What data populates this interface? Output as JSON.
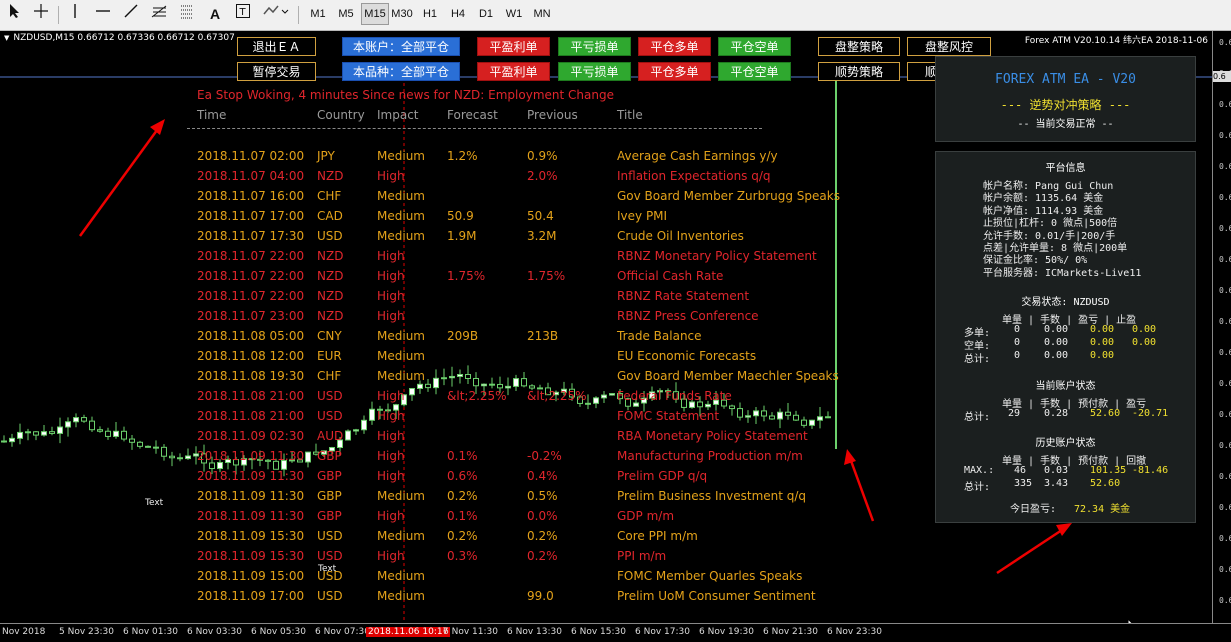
{
  "toolbar": {
    "timeframes": [
      "M1",
      "M5",
      "M15",
      "M30",
      "H1",
      "H4",
      "D1",
      "W1",
      "MN"
    ],
    "active_timeframe": "M15",
    "icons": [
      "cursor-icon",
      "crosshair-icon",
      "vertical-line-icon",
      "horizontal-line-icon",
      "trendline-icon",
      "fibonacci-icon",
      "grid-icon",
      "text-icon",
      "text-label-icon",
      "arrows-icon"
    ]
  },
  "chart": {
    "symbol_line": "NZDUSD,M15  0.66712 0.67336 0.66712 0.67307",
    "top_right": "Forex ATM  V20.10.14  纬六EA 2018-11-06",
    "price_tag": "0.6",
    "price_labels": [
      "0.6",
      "0.6",
      "0.6",
      "0.6",
      "0.6",
      "0.6",
      "0.6",
      "0.6",
      "0.6",
      "0.6",
      "0.6",
      "0.6",
      "0.6",
      "0.6",
      "0.6",
      "0.6",
      "0.6",
      "0.6",
      "0.6"
    ],
    "time_labels": [
      "Nov 2018",
      "5 Nov 23:30",
      "6 Nov 01:30",
      "6 Nov 03:30",
      "6 Nov 05:30",
      "6 Nov 07:30",
      "2018.11.06 10:17",
      "6 Nov 11:30",
      "6 Nov 13:30",
      "6 Nov 15:30",
      "6 Nov 17:30",
      "6 Nov 19:30",
      "6 Nov 21:30",
      "6 Nov 23:30"
    ],
    "text_labels": [
      "Text",
      "Text"
    ]
  },
  "buttons": {
    "row1": [
      "退出ＥＡ",
      "本账户：全部平仓",
      "平盈利单",
      "平亏损单",
      "平仓多单",
      "平仓空单",
      "盘整策略",
      "盘整风控"
    ],
    "row2": [
      "暂停交易",
      "本品种：全部平仓",
      "平盈利单",
      "平亏损单",
      "平仓多单",
      "平仓空单",
      "顺势策略",
      "顺势风控"
    ]
  },
  "news": {
    "title": "Ea Stop Woking, 4 minutes Since news for NZD: Employment Change",
    "headers": {
      "time": "Time",
      "country": "Country",
      "impact": "Impact",
      "forecast": "Forecast",
      "previous": "Previous",
      "title": "Title"
    },
    "rows": [
      {
        "time": "2018.11.07 02:00",
        "country": "JPY",
        "impact": "Medium",
        "forecast": "1.2%",
        "previous": "0.9%",
        "title": "Average Cash Earnings y/y"
      },
      {
        "time": "2018.11.07 04:00",
        "country": "NZD",
        "impact": "High",
        "forecast": "",
        "previous": "2.0%",
        "title": "Inflation Expectations q/q"
      },
      {
        "time": "2018.11.07 16:00",
        "country": "CHF",
        "impact": "Medium",
        "forecast": "",
        "previous": "",
        "title": "Gov Board Member Zurbrugg Speaks"
      },
      {
        "time": "2018.11.07 17:00",
        "country": "CAD",
        "impact": "Medium",
        "forecast": "50.9",
        "previous": "50.4",
        "title": "Ivey PMI"
      },
      {
        "time": "2018.11.07 17:30",
        "country": "USD",
        "impact": "Medium",
        "forecast": "1.9M",
        "previous": "3.2M",
        "title": "Crude Oil Inventories"
      },
      {
        "time": "2018.11.07 22:00",
        "country": "NZD",
        "impact": "High",
        "forecast": "",
        "previous": "",
        "title": "RBNZ Monetary Policy Statement"
      },
      {
        "time": "2018.11.07 22:00",
        "country": "NZD",
        "impact": "High",
        "forecast": "1.75%",
        "previous": "1.75%",
        "title": "Official Cash Rate"
      },
      {
        "time": "2018.11.07 22:00",
        "country": "NZD",
        "impact": "High",
        "forecast": "",
        "previous": "",
        "title": "RBNZ Rate Statement"
      },
      {
        "time": "2018.11.07 23:00",
        "country": "NZD",
        "impact": "High",
        "forecast": "",
        "previous": "",
        "title": "RBNZ Press Conference"
      },
      {
        "time": "2018.11.08 05:00",
        "country": "CNY",
        "impact": "Medium",
        "forecast": "209B",
        "previous": "213B",
        "title": "Trade Balance"
      },
      {
        "time": "2018.11.08 12:00",
        "country": "EUR",
        "impact": "Medium",
        "forecast": "",
        "previous": "",
        "title": "EU Economic Forecasts"
      },
      {
        "time": "2018.11.08 19:30",
        "country": "CHF",
        "impact": "Medium",
        "forecast": "",
        "previous": "",
        "title": "Gov Board Member Maechler Speaks"
      },
      {
        "time": "2018.11.08 21:00",
        "country": "USD",
        "impact": "High",
        "forecast": "&lt;2.25%",
        "previous": "&lt;2.25%",
        "title": "Federal Funds Rate"
      },
      {
        "time": "2018.11.08 21:00",
        "country": "USD",
        "impact": "High",
        "forecast": "",
        "previous": "",
        "title": "FOMC Statement"
      },
      {
        "time": "2018.11.09 02:30",
        "country": "AUD",
        "impact": "High",
        "forecast": "",
        "previous": "",
        "title": "RBA Monetary Policy Statement"
      },
      {
        "time": "2018.11.09 11:30",
        "country": "GBP",
        "impact": "High",
        "forecast": "0.1%",
        "previous": "-0.2%",
        "title": "Manufacturing Production m/m"
      },
      {
        "time": "2018.11.09 11:30",
        "country": "GBP",
        "impact": "High",
        "forecast": "0.6%",
        "previous": "0.4%",
        "title": "Prelim GDP q/q"
      },
      {
        "time": "2018.11.09 11:30",
        "country": "GBP",
        "impact": "Medium",
        "forecast": "0.2%",
        "previous": "0.5%",
        "title": "Prelim Business Investment q/q"
      },
      {
        "time": "2018.11.09 11:30",
        "country": "GBP",
        "impact": "High",
        "forecast": "0.1%",
        "previous": "0.0%",
        "title": "GDP m/m"
      },
      {
        "time": "2018.11.09 15:30",
        "country": "USD",
        "impact": "Medium",
        "forecast": "0.2%",
        "previous": "0.2%",
        "title": "Core PPI m/m"
      },
      {
        "time": "2018.11.09 15:30",
        "country": "USD",
        "impact": "High",
        "forecast": "0.3%",
        "previous": "0.2%",
        "title": "PPI m/m"
      },
      {
        "time": "2018.11.09 15:00",
        "country": "USD",
        "impact": "Medium",
        "forecast": "",
        "previous": "",
        "title": "FOMC Member Quarles Speaks"
      },
      {
        "time": "2018.11.09 17:00",
        "country": "USD",
        "impact": "Medium",
        "forecast": "",
        "previous": "99.0",
        "title": "Prelim UoM Consumer Sentiment"
      }
    ]
  },
  "ea_panel": {
    "title": "FOREX ATM EA - V20",
    "strategy": "--- 逆势对冲策略 ---",
    "status": "-- 当前交易正常 --"
  },
  "info_panel": {
    "platform_title": "平台信息",
    "platform_rows": [
      "帐户名称: Pang Gui Chun",
      "帐户余额: 1135.64 美金",
      "帐户净值: 1114.93 美金",
      "止损位|杠杆: 0 微点|500倍",
      "允许手数: 0.01/手|200/手",
      "点差|允许单量: 8 微点|200单",
      "保证金比率: 50%/ 0%",
      "平台服务器: ICMarkets-Live11"
    ],
    "trade_title": "交易状态: NZDUSD",
    "trade_header": "单量 | 手数 | 盈亏 | 止盈",
    "trade_rows": [
      {
        "label": "多单:",
        "count": "0",
        "lots": "0.00",
        "pnl": "0.00",
        "tp": "0.00"
      },
      {
        "label": "空单:",
        "count": "0",
        "lots": "0.00",
        "pnl": "0.00",
        "tp": "0.00"
      },
      {
        "label": "总计:",
        "count": "0",
        "lots": "0.00",
        "pnl": "0.00",
        "tp": ""
      }
    ],
    "account_title": "当前账户状态",
    "account_header": "单量 | 手数 | 预付款 | 盈亏",
    "account_row": {
      "label": "总计:",
      "count": "29",
      "lots": "0.28",
      "margin": "52.60",
      "pnl": "-20.71"
    },
    "history_title": "历史账户状态",
    "history_header": "单量 | 手数 | 预付款 | 回撤",
    "history_rows": [
      {
        "label": "MAX.:",
        "count": "46",
        "lots": "0.03",
        "margin": "101.35",
        "dd": "-81.46"
      },
      {
        "label": "总计:",
        "count": "335",
        "lots": "3.43",
        "margin": "52.60",
        "dd": ""
      }
    ],
    "today_label": "今日盈亏:",
    "today_value": "72.34 美金"
  }
}
